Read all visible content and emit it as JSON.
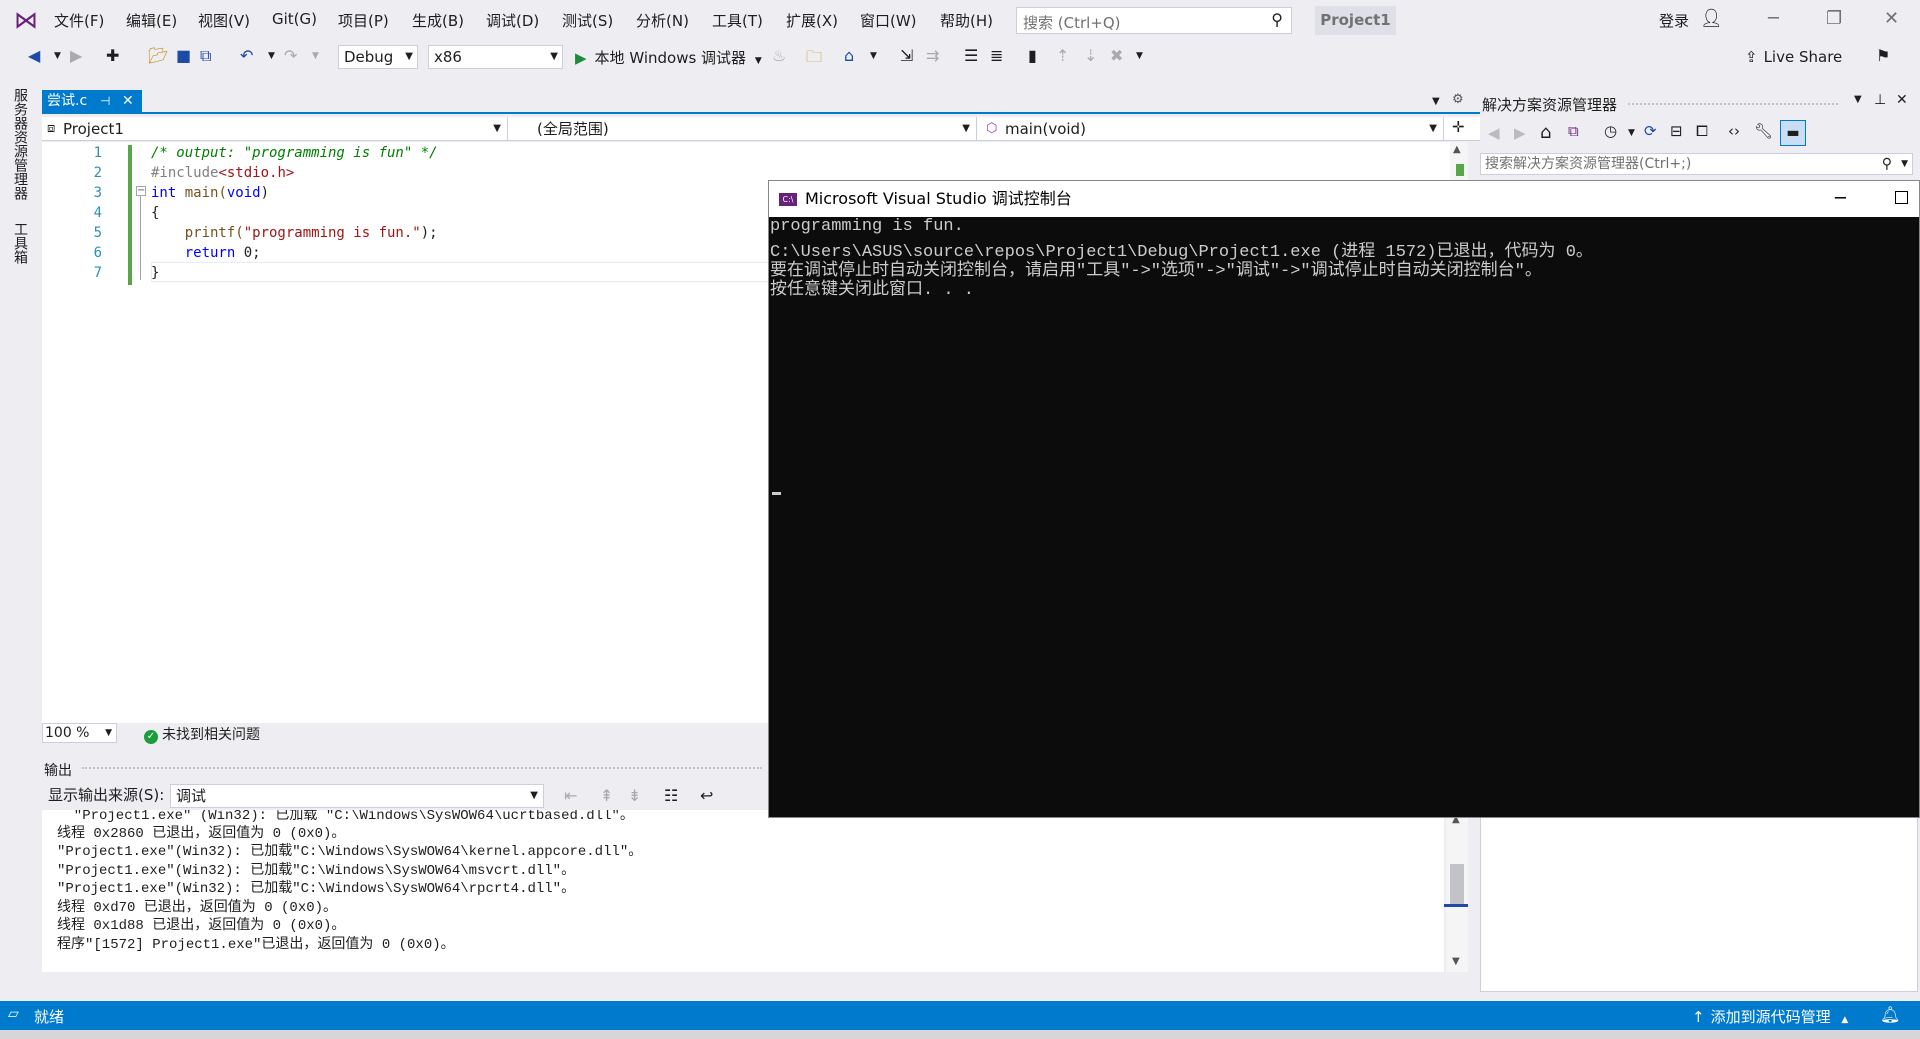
{
  "menu": {
    "items": [
      "文件(F)",
      "编辑(E)",
      "视图(V)",
      "Git(G)",
      "项目(P)",
      "生成(B)",
      "调试(D)",
      "测试(S)",
      "分析(N)",
      "工具(T)",
      "扩展(X)",
      "窗口(W)",
      "帮助(H)"
    ],
    "search_placeholder": "搜索 (Ctrl+Q)",
    "project_badge": "Project1",
    "login": "登录"
  },
  "toolbar": {
    "config": "Debug",
    "platform": "x86",
    "run_label": "本地 Windows 调试器",
    "live_share": "Live Share"
  },
  "side_tabs": [
    "服务器资源管理器",
    "工具箱"
  ],
  "document": {
    "tab_label": "尝试.c",
    "nav_project": "Project1",
    "nav_scope": "(全局范围)",
    "nav_member": "main(void)"
  },
  "code": {
    "line_numbers": [
      "1",
      "2",
      "3",
      "4",
      "5",
      "6",
      "7"
    ],
    "l1": "/* output: \"programming is fun\" */",
    "l2_pp": "#include",
    "l2_hdr": "<stdio.h>",
    "l3_kw": "int",
    "l3_fn": " main(",
    "l3_void": "void",
    "l3_end": ")",
    "l4": "{",
    "l5_fn": "    printf(",
    "l5_str": "\"programming is fun.\"",
    "l5_end": ");",
    "l6_kw": "    return",
    "l6_end": " 0;",
    "l7": "}"
  },
  "editor_status": {
    "zoom": "100 %",
    "issues": "未找到相关问题"
  },
  "output": {
    "title": "输出",
    "source_label": "显示输出来源(S):",
    "source_value": "调试",
    "lines": [
      "  \"Project1.exe\" (Win32): 已加载 \"C:\\Windows\\SysWOW64\\ucrtbased.dll\"。",
      "线程 0x2860 已退出，返回值为 0 (0x0)。",
      "\"Project1.exe\"(Win32): 已加载\"C:\\Windows\\SysWOW64\\kernel.appcore.dll\"。",
      "\"Project1.exe\"(Win32): 已加载\"C:\\Windows\\SysWOW64\\msvcrt.dll\"。",
      "\"Project1.exe\"(Win32): 已加载\"C:\\Windows\\SysWOW64\\rpcrt4.dll\"。",
      "线程 0xd70 已退出，返回值为 0 (0x0)。",
      "线程 0x1d88 已退出，返回值为 0 (0x0)。",
      "程序\"[1572] Project1.exe\"已退出，返回值为 0 (0x0)。"
    ]
  },
  "solution_explorer": {
    "title": "解决方案资源管理器",
    "search_placeholder": "搜索解决方案资源管理器(Ctrl+;)"
  },
  "console": {
    "title": "Microsoft Visual Studio 调试控制台",
    "icon_text": "C:\\",
    "lines": [
      "programming is fun.",
      "C:\\Users\\ASUS\\source\\repos\\Project1\\Debug\\Project1.exe (进程 1572)已退出，代码为 0。",
      "要在调试停止时自动关闭控制台，请启用\"工具\"->\"选项\"->\"调试\"->\"调试停止时自动关闭控制台\"。",
      "按任意键关闭此窗口. . ."
    ]
  },
  "statusbar": {
    "ready": "就绪",
    "source_control": "添加到源代码管理"
  }
}
